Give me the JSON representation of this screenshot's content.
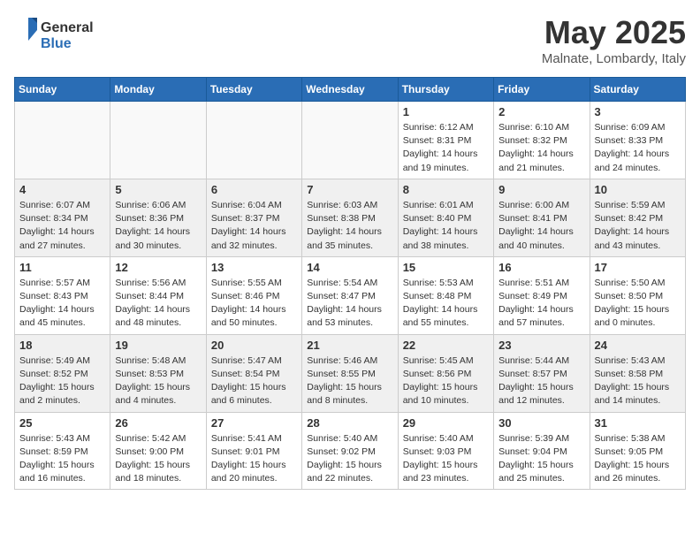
{
  "logo": {
    "general": "General",
    "blue": "Blue"
  },
  "title": "May 2025",
  "location": "Malnate, Lombardy, Italy",
  "weekdays": [
    "Sunday",
    "Monday",
    "Tuesday",
    "Wednesday",
    "Thursday",
    "Friday",
    "Saturday"
  ],
  "weeks": [
    [
      {
        "day": "",
        "info": "",
        "empty": true
      },
      {
        "day": "",
        "info": "",
        "empty": true
      },
      {
        "day": "",
        "info": "",
        "empty": true
      },
      {
        "day": "",
        "info": "",
        "empty": true
      },
      {
        "day": "1",
        "info": "Sunrise: 6:12 AM\nSunset: 8:31 PM\nDaylight: 14 hours\nand 19 minutes.",
        "empty": false
      },
      {
        "day": "2",
        "info": "Sunrise: 6:10 AM\nSunset: 8:32 PM\nDaylight: 14 hours\nand 21 minutes.",
        "empty": false
      },
      {
        "day": "3",
        "info": "Sunrise: 6:09 AM\nSunset: 8:33 PM\nDaylight: 14 hours\nand 24 minutes.",
        "empty": false
      }
    ],
    [
      {
        "day": "4",
        "info": "Sunrise: 6:07 AM\nSunset: 8:34 PM\nDaylight: 14 hours\nand 27 minutes.",
        "empty": false
      },
      {
        "day": "5",
        "info": "Sunrise: 6:06 AM\nSunset: 8:36 PM\nDaylight: 14 hours\nand 30 minutes.",
        "empty": false
      },
      {
        "day": "6",
        "info": "Sunrise: 6:04 AM\nSunset: 8:37 PM\nDaylight: 14 hours\nand 32 minutes.",
        "empty": false
      },
      {
        "day": "7",
        "info": "Sunrise: 6:03 AM\nSunset: 8:38 PM\nDaylight: 14 hours\nand 35 minutes.",
        "empty": false
      },
      {
        "day": "8",
        "info": "Sunrise: 6:01 AM\nSunset: 8:40 PM\nDaylight: 14 hours\nand 38 minutes.",
        "empty": false
      },
      {
        "day": "9",
        "info": "Sunrise: 6:00 AM\nSunset: 8:41 PM\nDaylight: 14 hours\nand 40 minutes.",
        "empty": false
      },
      {
        "day": "10",
        "info": "Sunrise: 5:59 AM\nSunset: 8:42 PM\nDaylight: 14 hours\nand 43 minutes.",
        "empty": false
      }
    ],
    [
      {
        "day": "11",
        "info": "Sunrise: 5:57 AM\nSunset: 8:43 PM\nDaylight: 14 hours\nand 45 minutes.",
        "empty": false
      },
      {
        "day": "12",
        "info": "Sunrise: 5:56 AM\nSunset: 8:44 PM\nDaylight: 14 hours\nand 48 minutes.",
        "empty": false
      },
      {
        "day": "13",
        "info": "Sunrise: 5:55 AM\nSunset: 8:46 PM\nDaylight: 14 hours\nand 50 minutes.",
        "empty": false
      },
      {
        "day": "14",
        "info": "Sunrise: 5:54 AM\nSunset: 8:47 PM\nDaylight: 14 hours\nand 53 minutes.",
        "empty": false
      },
      {
        "day": "15",
        "info": "Sunrise: 5:53 AM\nSunset: 8:48 PM\nDaylight: 14 hours\nand 55 minutes.",
        "empty": false
      },
      {
        "day": "16",
        "info": "Sunrise: 5:51 AM\nSunset: 8:49 PM\nDaylight: 14 hours\nand 57 minutes.",
        "empty": false
      },
      {
        "day": "17",
        "info": "Sunrise: 5:50 AM\nSunset: 8:50 PM\nDaylight: 15 hours\nand 0 minutes.",
        "empty": false
      }
    ],
    [
      {
        "day": "18",
        "info": "Sunrise: 5:49 AM\nSunset: 8:52 PM\nDaylight: 15 hours\nand 2 minutes.",
        "empty": false
      },
      {
        "day": "19",
        "info": "Sunrise: 5:48 AM\nSunset: 8:53 PM\nDaylight: 15 hours\nand 4 minutes.",
        "empty": false
      },
      {
        "day": "20",
        "info": "Sunrise: 5:47 AM\nSunset: 8:54 PM\nDaylight: 15 hours\nand 6 minutes.",
        "empty": false
      },
      {
        "day": "21",
        "info": "Sunrise: 5:46 AM\nSunset: 8:55 PM\nDaylight: 15 hours\nand 8 minutes.",
        "empty": false
      },
      {
        "day": "22",
        "info": "Sunrise: 5:45 AM\nSunset: 8:56 PM\nDaylight: 15 hours\nand 10 minutes.",
        "empty": false
      },
      {
        "day": "23",
        "info": "Sunrise: 5:44 AM\nSunset: 8:57 PM\nDaylight: 15 hours\nand 12 minutes.",
        "empty": false
      },
      {
        "day": "24",
        "info": "Sunrise: 5:43 AM\nSunset: 8:58 PM\nDaylight: 15 hours\nand 14 minutes.",
        "empty": false
      }
    ],
    [
      {
        "day": "25",
        "info": "Sunrise: 5:43 AM\nSunset: 8:59 PM\nDaylight: 15 hours\nand 16 minutes.",
        "empty": false
      },
      {
        "day": "26",
        "info": "Sunrise: 5:42 AM\nSunset: 9:00 PM\nDaylight: 15 hours\nand 18 minutes.",
        "empty": false
      },
      {
        "day": "27",
        "info": "Sunrise: 5:41 AM\nSunset: 9:01 PM\nDaylight: 15 hours\nand 20 minutes.",
        "empty": false
      },
      {
        "day": "28",
        "info": "Sunrise: 5:40 AM\nSunset: 9:02 PM\nDaylight: 15 hours\nand 22 minutes.",
        "empty": false
      },
      {
        "day": "29",
        "info": "Sunrise: 5:40 AM\nSunset: 9:03 PM\nDaylight: 15 hours\nand 23 minutes.",
        "empty": false
      },
      {
        "day": "30",
        "info": "Sunrise: 5:39 AM\nSunset: 9:04 PM\nDaylight: 15 hours\nand 25 minutes.",
        "empty": false
      },
      {
        "day": "31",
        "info": "Sunrise: 5:38 AM\nSunset: 9:05 PM\nDaylight: 15 hours\nand 26 minutes.",
        "empty": false
      }
    ]
  ]
}
